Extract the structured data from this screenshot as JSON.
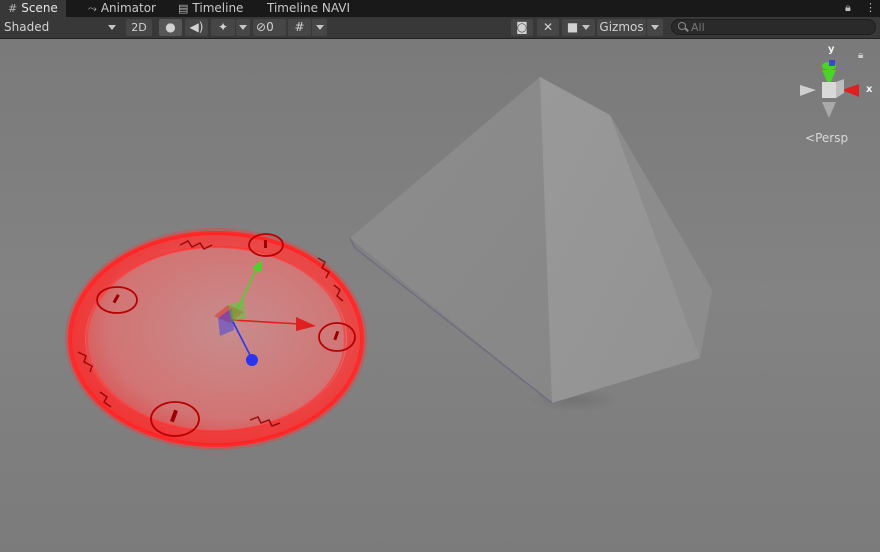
{
  "tabs": [
    {
      "label": "Scene",
      "icon": "grid-icon",
      "active": true
    },
    {
      "label": "Animator",
      "icon": "animator-icon",
      "active": false
    },
    {
      "label": "Timeline",
      "icon": "film-icon",
      "active": false
    },
    {
      "label": "Timeline NAVI",
      "icon": "",
      "active": false
    }
  ],
  "toolbar": {
    "shading_mode": "Shaded",
    "mode_2d": "2D",
    "hidden_count": "0",
    "gizmos": "Gizmos",
    "search_placeholder": "All"
  },
  "gizmo": {
    "y_label": "y",
    "x_label": "x",
    "projection": "Persp"
  },
  "colors": {
    "x_axis": "#e02020",
    "y_axis": "#49d42a",
    "z_axis": "#2b35f0",
    "highlight": "#ff2a2a"
  }
}
